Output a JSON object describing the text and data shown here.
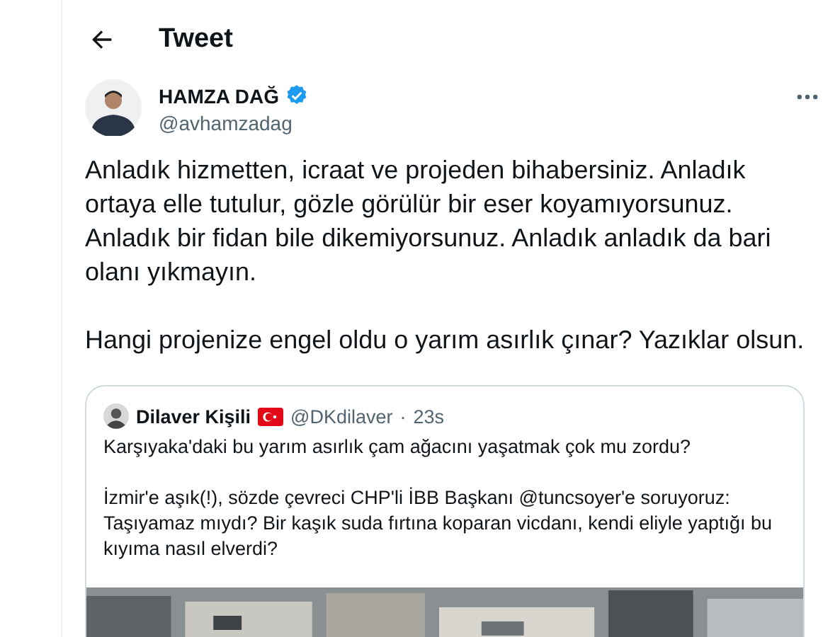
{
  "header": {
    "title": "Tweet"
  },
  "tweet": {
    "author": {
      "name": "HAMZA DAĞ",
      "verified": true,
      "handle": "@avhamzadag"
    },
    "paragraphs": [
      "Anladık hizmetten, icraat ve projeden bihabersiniz. Anladık ortaya elle tutulur, gözle görülür bir eser koyamıyorsunuz. Anladık bir fidan bile dikemiyorsunuz. Anladık anladık da bari olanı yıkmayın.",
      "Hangi projenize engel oldu o yarım asırlık çınar? Yazıklar olsun."
    ],
    "quote": {
      "name": "Dilaver Kişili",
      "handle": "@DKdilaver",
      "separator": "·",
      "time": "23s",
      "paragraphs": [
        "Karşıyaka'daki bu yarım asırlık çam ağacını yaşatmak çok mu zordu?",
        "İzmir'e aşık(!), sözde çevreci CHP'li İBB Başkanı @tuncsoyer'e soruyoruz: Taşıyamaz mıydı? Bir kaşık suda fırtına koparan vicdanı, kendi eliyle yaptığı bu kıyıma nasıl elverdi?"
      ]
    }
  }
}
